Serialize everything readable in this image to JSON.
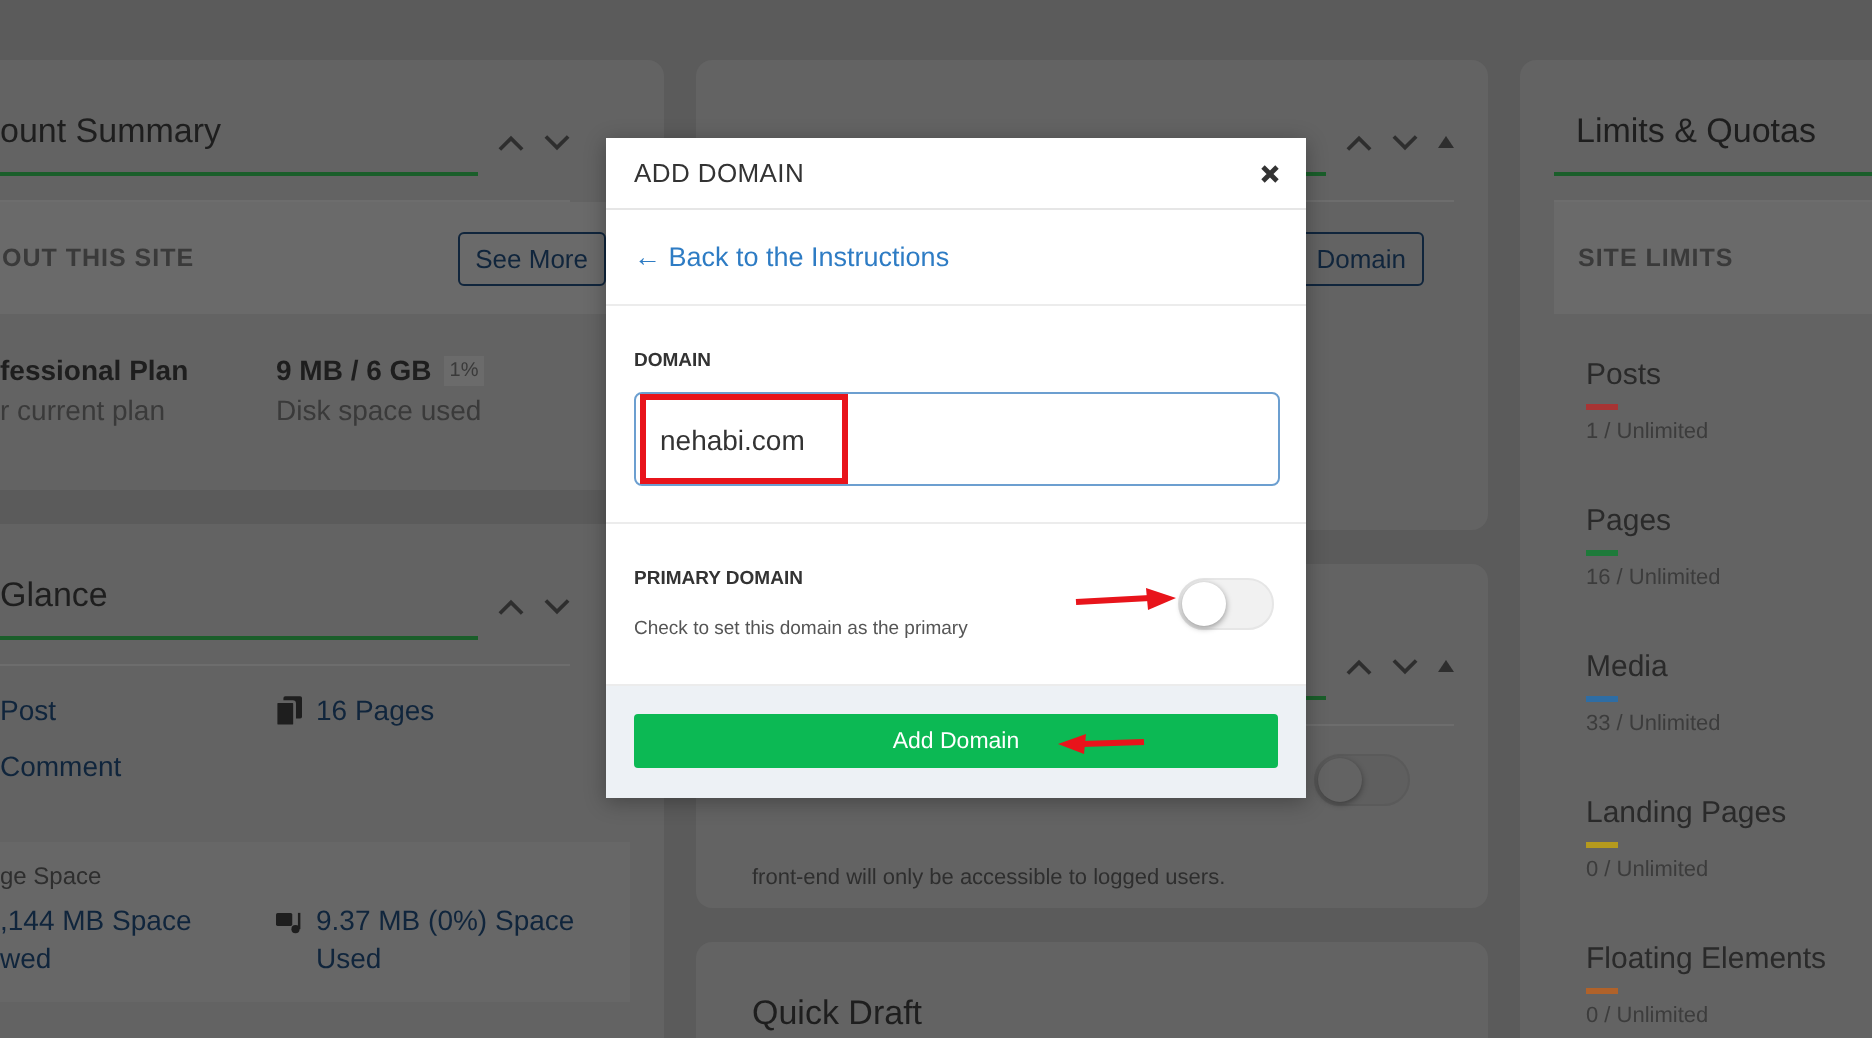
{
  "account_summary": {
    "title": "ount Summary",
    "section": "OUT THIS SITE",
    "see_more": "See More",
    "plan": {
      "name": "fessional Plan",
      "caption": "r current plan"
    },
    "disk": {
      "value": "9 MB / 6 GB",
      "percent": "1%",
      "caption": "Disk space used"
    }
  },
  "at_a_glance": {
    "title": "Glance",
    "items": [
      {
        "kind": "plain",
        "text": "Post"
      },
      {
        "kind": "pages",
        "text": "16 Pages"
      },
      {
        "kind": "plain",
        "text": "Comment"
      }
    ],
    "storage": {
      "title": "ge Space",
      "allowed": ",144 MB Space wed",
      "used": "9.37 MB (0%) Space Used"
    }
  },
  "domains": {
    "add_button": "Domain"
  },
  "maintenance": {
    "description": "front-end will only be accessible to logged users.",
    "on": false
  },
  "quick_draft": {
    "title": "Quick Draft"
  },
  "limits": {
    "title": "Limits & Quotas",
    "section": "SITE LIMITS",
    "items": [
      {
        "name": "Posts",
        "color": "#a83434",
        "count": "1 / Unlimited"
      },
      {
        "name": "Pages",
        "color": "#1e7a3a",
        "count": "16 / Unlimited"
      },
      {
        "name": "Media",
        "color": "#2e6da4",
        "count": "33 / Unlimited"
      },
      {
        "name": "Landing Pages",
        "color": "#b59a1e",
        "count": "0 / Unlimited"
      },
      {
        "name": "Floating Elements",
        "color": "#b0622a",
        "count": "0 / Unlimited"
      }
    ]
  },
  "modal": {
    "title": "ADD DOMAIN",
    "back_link": "← Back to the Instructions",
    "domain_label": "DOMAIN",
    "domain_value": "nehabi.com",
    "primary_label": "PRIMARY DOMAIN",
    "primary_help": "Check to set this domain as the primary",
    "primary_on": false,
    "submit": "Add Domain"
  }
}
